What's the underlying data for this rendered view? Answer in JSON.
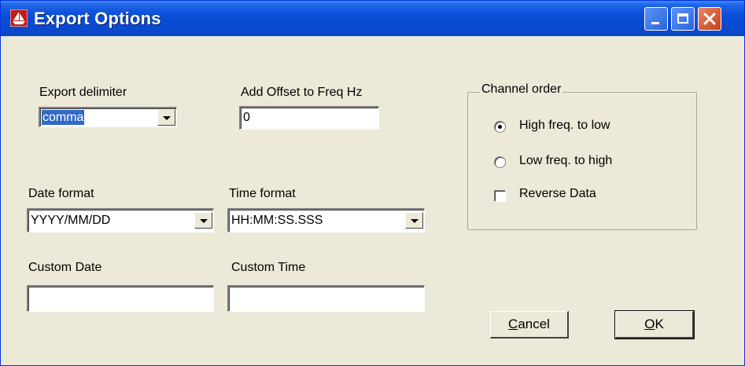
{
  "window": {
    "title": "Export Options"
  },
  "export_delimiter": {
    "label": "Export delimiter",
    "value": "comma"
  },
  "offset": {
    "label": "Add Offset to Freq Hz",
    "value": "0"
  },
  "date_format": {
    "label": "Date format",
    "value": "YYYY/MM/DD"
  },
  "time_format": {
    "label": "Time format",
    "value": "HH:MM:SS.SSS"
  },
  "custom_date": {
    "label": "Custom Date",
    "value": ""
  },
  "custom_time": {
    "label": "Custom Time",
    "value": ""
  },
  "channel_order": {
    "title": "Channel order",
    "options": [
      {
        "label": "High freq. to low",
        "selected": true
      },
      {
        "label": "Low freq. to high",
        "selected": false
      }
    ],
    "reverse_label": "Reverse Data",
    "reverse_checked": false
  },
  "buttons": {
    "cancel_mnemonic": "C",
    "cancel_rest": "ancel",
    "ok_mnemonic": "O",
    "ok_rest": "K"
  }
}
